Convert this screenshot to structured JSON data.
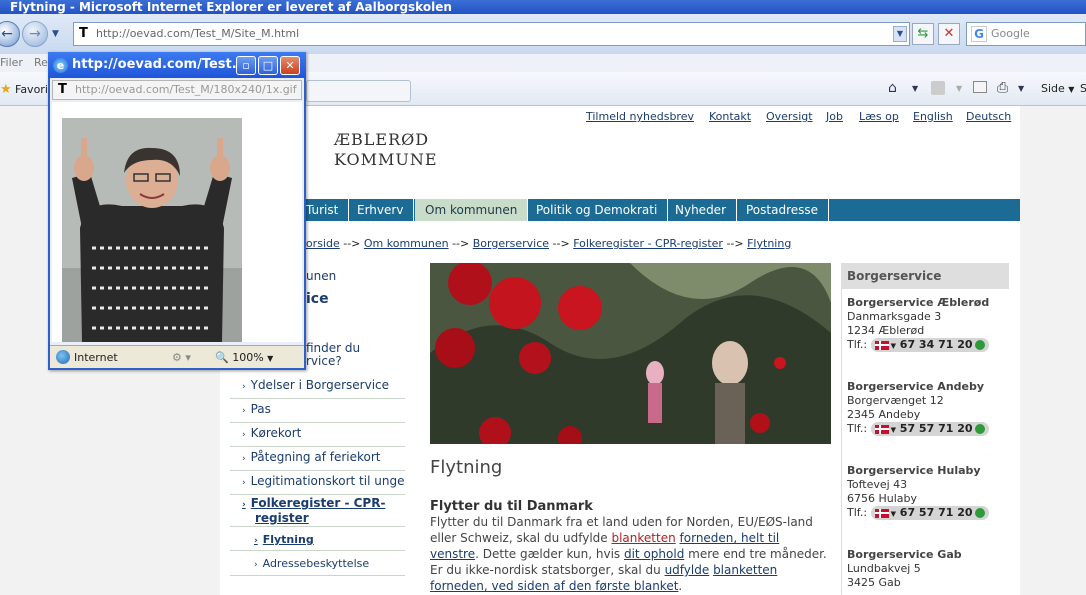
{
  "browser": {
    "title": "Flytning - Microsoft Internet Explorer er leveret af Aalborgskolen",
    "address": "http://oevad.com/Test_M/Site_M.html",
    "search_placeholder": "Google",
    "menu_filer": "Filer",
    "menu_re": "Re",
    "favorites": "Favorit",
    "side_label": "Side"
  },
  "site": {
    "top_links": [
      "Tilmeld nyhedsbrev",
      "Kontakt",
      "Oversigt",
      "Job",
      "Læs op",
      "English",
      "Deutsch"
    ],
    "logo_line1": "ÆBLERØD",
    "logo_line2": "KOMMUNE",
    "nav": [
      "Turist",
      "Erhverv",
      "Om kommunen",
      "Politik og Demokrati",
      "Nyheder",
      "Postadresse"
    ],
    "active_nav": "Om kommunen",
    "breadcrumb": [
      "Forside",
      "Om kommunen",
      "Borgerservice",
      "Folkeregister - CPR-register",
      "Flytning"
    ],
    "breadcrumb_sep": " --> ",
    "left_menu": {
      "partial1": "unen",
      "partial2": "ice",
      "partial3a": "finder du",
      "partial3b": "rvice?",
      "items": [
        "Ydelser i Borgerservice",
        "Pas",
        "Kørekort",
        "Påtegning af feriekort",
        "Legitimationskort til unge"
      ],
      "bold_item_line1": "Folkeregister - CPR-",
      "bold_item_line2": "register",
      "sub_active": "Flytning",
      "sub_other": "Adressebeskyttelse"
    },
    "page_title": "Flytning",
    "subheading": "Flytter du til Danmark",
    "body": {
      "t1": "Flytter du til Danmark fra et land uden for Norden, EU/EØS-land eller Schweiz, skal du udfylde ",
      "l1": "blanketten",
      "t2": " ",
      "l2": "forneden, helt til venstre",
      "t3": ". Dette gælder kun, hvis ",
      "l3": "dit ophold",
      "t4": " mere end tre måneder. Er du ikke-nordisk statsborger, skal du ",
      "l4": "udfylde",
      "t5": " ",
      "l5": "blanketten",
      "t6": " ",
      "l6": "forneden, ved siden af den første blanket",
      "t7": "."
    },
    "sidebar": {
      "heading": "Borgerservice",
      "phone_label": "Tlf.:",
      "offices": [
        {
          "name": "Borgerservice Æblerød",
          "street": "Danmarksgade 3",
          "city": "1234 Æblerød",
          "phone": "67 34 71 20"
        },
        {
          "name": "Borgerservice Andeby",
          "street": "Borgervænget 12",
          "city": "2345 Andeby",
          "phone": "57 57 71 20"
        },
        {
          "name": "Borgerservice Hulaby",
          "street": "Toftevej 43",
          "city": "6756 Hulaby",
          "phone": "67 57 71 20"
        },
        {
          "name": "Borgerservice Gab",
          "street": "Lundbakvej 5",
          "city": "3425 Gab",
          "phone": ""
        }
      ]
    }
  },
  "popup": {
    "title": "http://oevad.com/Test...",
    "address": "http://oevad.com/Test_M/180x240/1x.gif",
    "zone": "Internet",
    "zoom": "100%"
  },
  "colors": {
    "nav_bg": "#1c6b94",
    "nav_active": "#c9dbc9",
    "link": "#1a3c6e",
    "ie_blue": "#2452c4"
  }
}
